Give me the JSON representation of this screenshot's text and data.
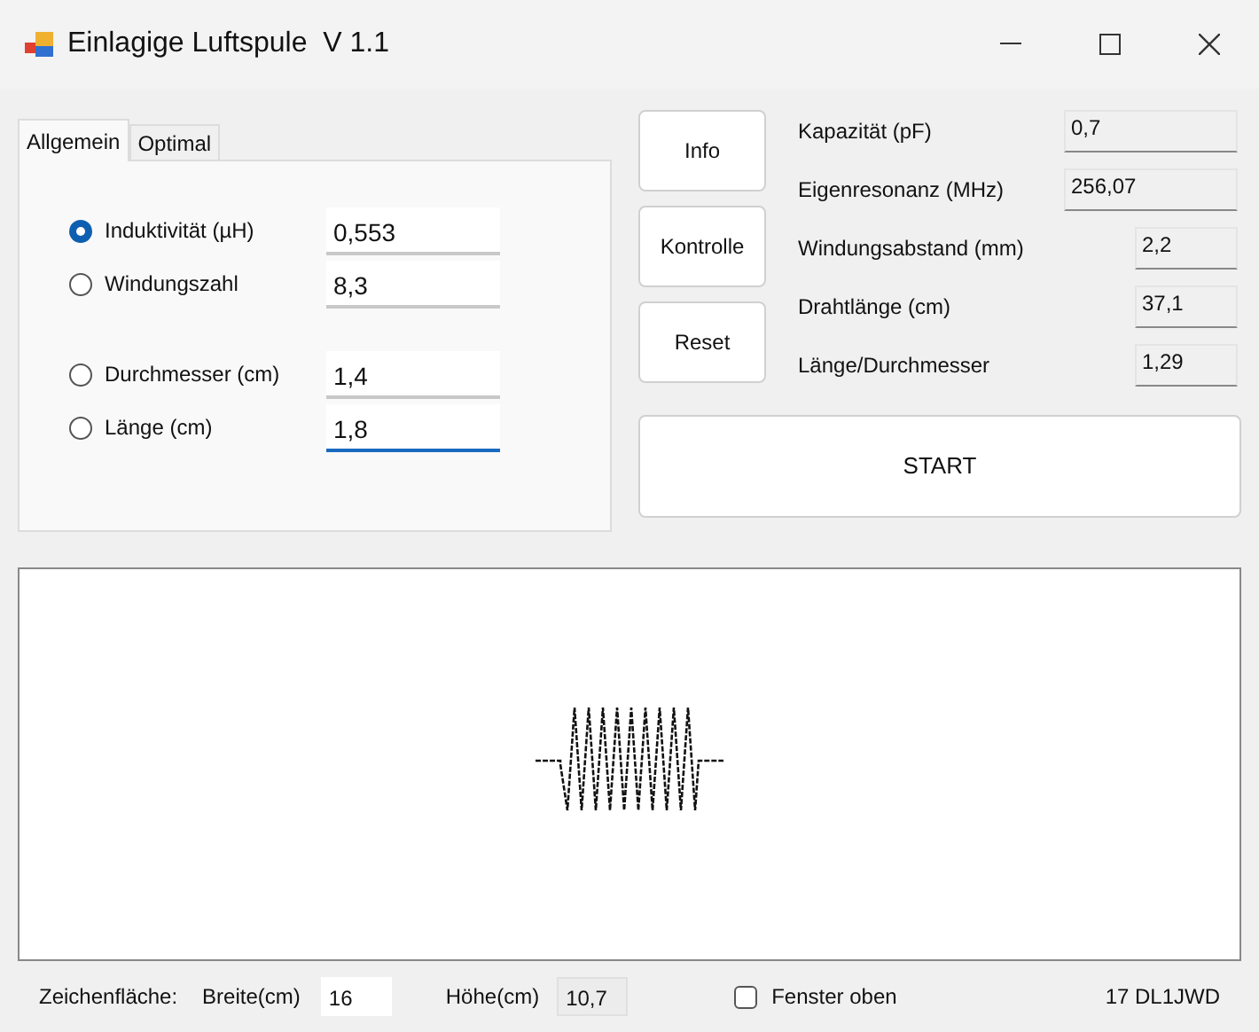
{
  "window": {
    "title": "Einlagige Luftspule  V 1.1"
  },
  "tabs": [
    {
      "label": "Allgemein",
      "selected": true
    },
    {
      "label": "Optimal",
      "selected": false
    }
  ],
  "inputs": [
    {
      "label": "Induktivität (µH)",
      "value": "0,553",
      "selected": true,
      "focused": false
    },
    {
      "label": "Windungszahl",
      "value": "8,3",
      "selected": false,
      "focused": false
    },
    {
      "label": "Durchmesser (cm)",
      "value": "1,4",
      "selected": false,
      "focused": false
    },
    {
      "label": "Länge (cm)",
      "value": "1,8",
      "selected": false,
      "focused": true
    }
  ],
  "buttons": [
    "Info",
    "Kontrolle",
    "Reset"
  ],
  "results": [
    {
      "label": "Kapazität (pF)",
      "value": "0,7"
    },
    {
      "label": "Eigenresonanz (MHz)",
      "value": "256,07"
    },
    {
      "label": "Windungsabstand (mm)",
      "value": "2,2"
    },
    {
      "label": "Drahtlänge (cm)",
      "value": "37,1"
    },
    {
      "label": "Länge/Durchmesser",
      "value": "1,29"
    }
  ],
  "start_button": "START",
  "footer": {
    "label": "Zeichenfläche:",
    "width_label": "Breite(cm)",
    "width_value": "16",
    "height_label": "Höhe(cm)",
    "height_value": "10,7",
    "checkbox": {
      "label": "Fenster oben",
      "checked": false
    },
    "author": "17 DL1JWD"
  }
}
